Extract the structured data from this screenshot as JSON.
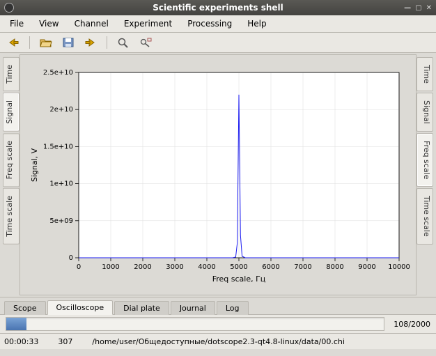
{
  "titlebar": {
    "title": "Scientific experiments shell"
  },
  "menubar": {
    "items": [
      "File",
      "View",
      "Channel",
      "Experiment",
      "Processing",
      "Help"
    ]
  },
  "toolbar": {
    "items": [
      {
        "name": "back-icon",
        "group": 0
      },
      {
        "name": "open-icon",
        "group": 1
      },
      {
        "name": "save-icon",
        "group": 1
      },
      {
        "name": "export-icon",
        "group": 1
      },
      {
        "name": "zoom-icon",
        "group": 2
      },
      {
        "name": "measure-icon",
        "group": 2
      }
    ]
  },
  "left_tabs": [
    "Time",
    "Signal",
    "Freq scale",
    "Time scale"
  ],
  "left_tab_active": "Signal",
  "right_tabs": [
    "Time",
    "Signal",
    "Freq scale",
    "Time scale"
  ],
  "right_tab_active": "Freq scale",
  "bottom_tabs": [
    "Scope",
    "Oscilloscope",
    "Dial plate",
    "Journal",
    "Log"
  ],
  "bottom_tab_active": "Oscilloscope",
  "progress": {
    "value": 108,
    "max": 2000,
    "label": "108/2000"
  },
  "status": {
    "time": "00:00:33",
    "frame": "307",
    "path": "/home/user/Общедоступные/dotscope2.3-qt4.8-linux/data/00.chi"
  },
  "chart_data": {
    "type": "line",
    "title": "",
    "xlabel": "Freq scale, Гц",
    "ylabel": "Signal, V",
    "xlim": [
      0,
      10000
    ],
    "ylim": [
      0,
      25000000000.0
    ],
    "xticks": [
      0,
      1000,
      2000,
      3000,
      4000,
      5000,
      6000,
      7000,
      8000,
      9000,
      10000
    ],
    "yticks": [
      0,
      5000000000.0,
      10000000000.0,
      15000000000.0,
      20000000000.0,
      25000000000.0
    ],
    "ytick_labels": [
      "0",
      "5e+09",
      "1e+10",
      "1.5e+10",
      "2e+10",
      "2.5e+10"
    ],
    "grid": true,
    "series": [
      {
        "name": "Signal",
        "color": "#1a1af0",
        "x": [
          0,
          4800,
          4900,
          4950,
          5000,
          5050,
          5100,
          5200,
          5400,
          10000
        ],
        "y": [
          0,
          0,
          100000000.0,
          2000000000.0,
          22000000000.0,
          3000000000.0,
          200000000.0,
          0,
          0,
          0
        ]
      }
    ]
  }
}
